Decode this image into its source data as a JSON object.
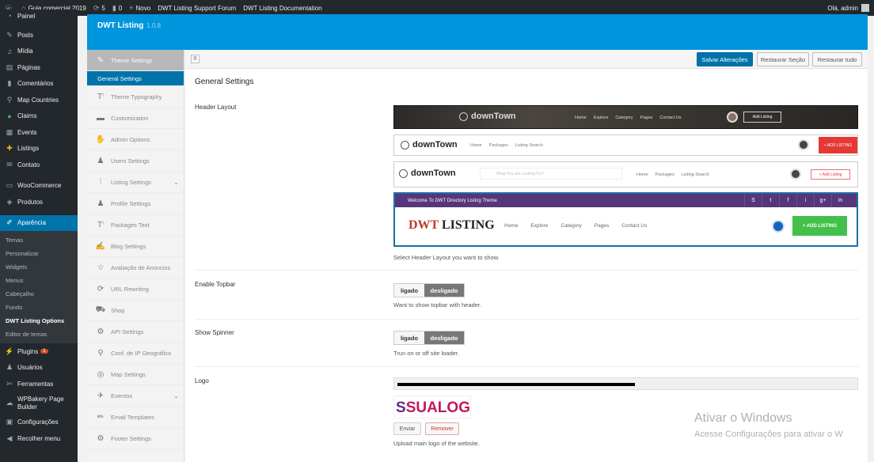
{
  "adminbar": {
    "site": "Guia comercial 2019",
    "updates": "5",
    "comments": "0",
    "new": "Novo",
    "link1": "DWT Listing Support Forum",
    "link2": "DWT Listing Documentation",
    "greeting": "Olá, admin"
  },
  "menu": {
    "painel": "Painel",
    "posts": "Posts",
    "midia": "Mídia",
    "paginas": "Páginas",
    "comentarios": "Comentários",
    "map_countries": "Map Countries",
    "claims": "Claims",
    "events": "Events",
    "listings": "Listings",
    "contato": "Contato",
    "woocommerce": "WooCommerce",
    "produtos": "Produtos",
    "aparencia": "Aparência",
    "sub": [
      "Temas",
      "Personalizar",
      "Widgets",
      "Menus",
      "Cabeçalho",
      "Fundo",
      "DWT Listing Options",
      "Editor de temas"
    ],
    "plugins": "Plugins",
    "plugins_badge": "1",
    "usuarios": "Usuários",
    "ferramentas": "Ferramentas",
    "wpbakery": "WPBakery Page Builder",
    "configuracoes": "Configurações",
    "recolher": "Recolher menu"
  },
  "options_header": {
    "title": "DWT Listing",
    "version": "1.0.8"
  },
  "options_nav": {
    "theme_settings": "Theme Settings",
    "general_settings": "General Settings",
    "items": [
      "Theme Typography",
      "Customization",
      "Admin Options",
      "Users Settings",
      "Listing Settings",
      "Profile Settings",
      "Packages Text",
      "Blog Settings",
      "Avaliação de Anúncios",
      "URL Rewriting",
      "Shop",
      "API Settings",
      "Conf. de IP Geográfico",
      "Map Settings",
      "Eventos",
      "Email Templates",
      "Footer Settings"
    ]
  },
  "toolbar": {
    "save": "Salvar Alterações",
    "reset_section": "Restaurar Seção",
    "reset_all": "Restaurar tudo"
  },
  "main": {
    "section_title": "General Settings",
    "header_layout_label": "Header Layout",
    "header_layout_desc": "Select Header Layout you want to show.",
    "topbar_label": "Enable Topbar",
    "topbar_desc": "Want to show topbar with header.",
    "spinner_label": "Show Spinner",
    "spinner_desc": "Trun on or off site loader.",
    "logo_label": "Logo",
    "logo_desc": "Upload main logo of the website.",
    "toggle_on": "ligado",
    "toggle_off": "desligado",
    "upload": "Enviar",
    "remove": "Remover",
    "logo_text_a": "S",
    "logo_text_b": "SUALOG"
  },
  "previews": {
    "brand_downtown": "downTown",
    "nav1": [
      "Home",
      "Explore",
      "Category",
      "Pages",
      "Contact Us"
    ],
    "add_listing_small": "Add Listing",
    "nav2": [
      "Home",
      "Packages",
      "Listing Search"
    ],
    "add_listing_caps": "+ ADD LISTING",
    "search_placeholder": "What You are Looking For?",
    "nav3": [
      "Home",
      "Packages",
      "Listing Search"
    ],
    "add_listing_outline": "+ Add Listing",
    "welcome": "Welcome To DWT Directory Listing Theme",
    "social": [
      "S",
      "t",
      "f",
      "i",
      "g+",
      "in"
    ],
    "brand_dwt_a": "DWT",
    "brand_dwt_b": " LISTING",
    "nav4": [
      "Home",
      "Explore",
      "Category",
      "Pages",
      "Contact Us"
    ],
    "add_listing_green": "+ ADD LISTING"
  },
  "watermark": {
    "line1": "Ativar o Windows",
    "line2": "Acesse Configurações para ativar o W"
  }
}
